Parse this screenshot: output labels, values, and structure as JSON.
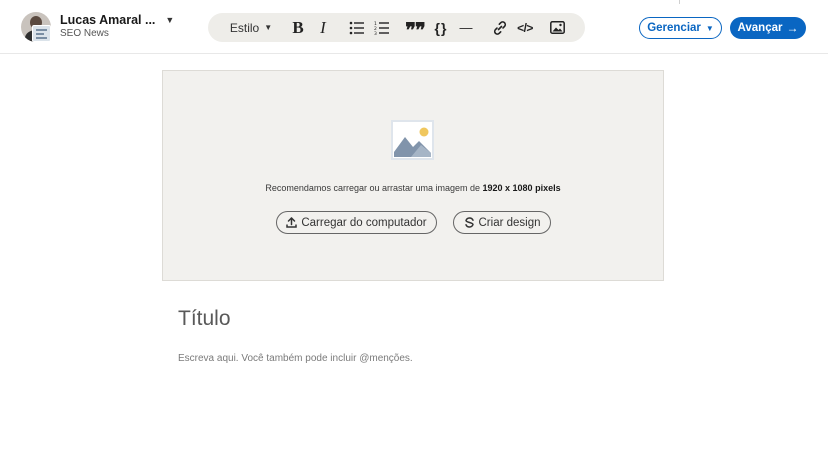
{
  "author": {
    "name": "Lucas Amaral ...",
    "page": "SEO News"
  },
  "toolbar": {
    "style_label": "Estilo",
    "bold": "B",
    "italic": "I",
    "quote": "❞❞",
    "code": "{}",
    "divider": "—",
    "html": "</>"
  },
  "actions": {
    "manage_label": "Gerenciar",
    "next_label": "Avançar",
    "next_arrow": "→"
  },
  "cover": {
    "recommendation_prefix": "Recomendamos carregar ou arrastar uma imagem de ",
    "recommendation_size": "1920 x 1080 pixels",
    "upload_label": "Carregar do computador",
    "design_label": "Criar design"
  },
  "editor": {
    "title_placeholder": "Título",
    "body_placeholder": "Escreva aqui. Você também pode incluir @menções."
  },
  "colors": {
    "accent": "#0a66c2",
    "toolbar_bg": "#eeede9",
    "cover_bg": "#f2f1ee"
  }
}
